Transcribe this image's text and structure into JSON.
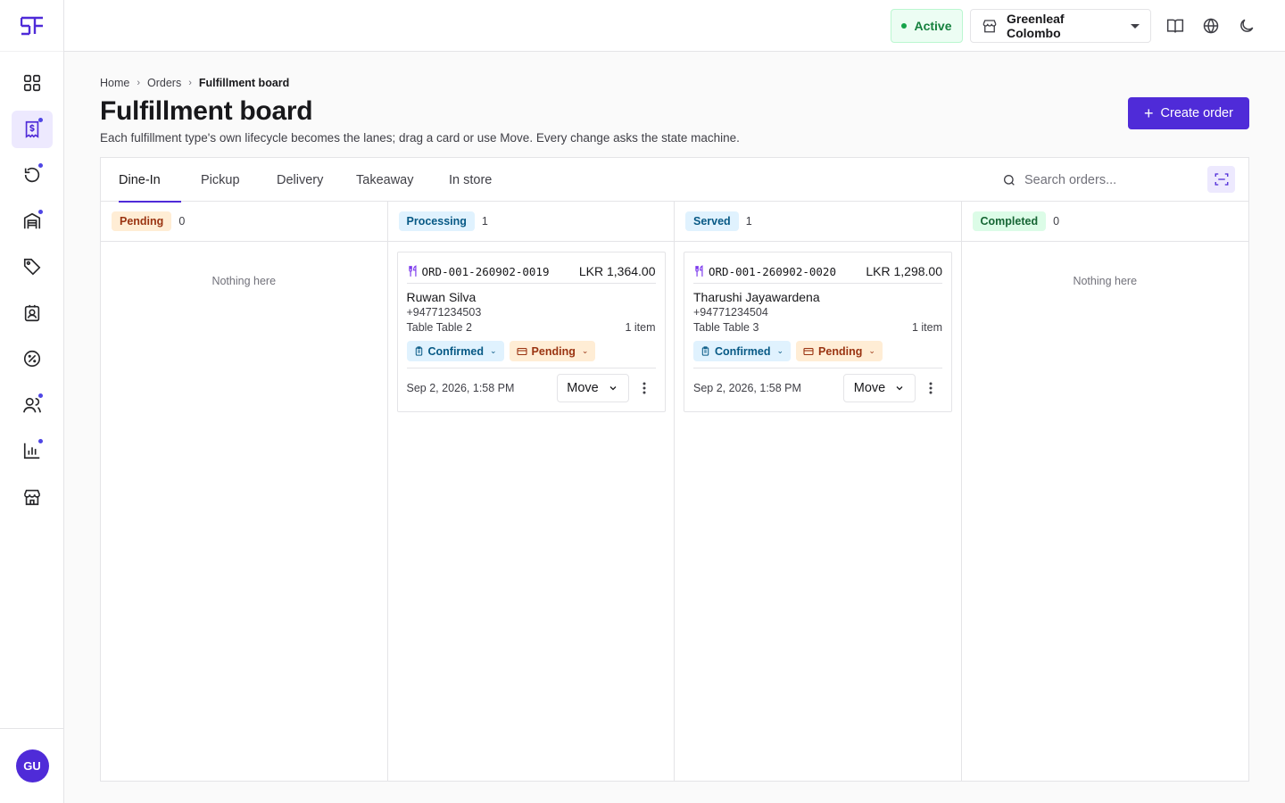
{
  "app": {
    "logo_icon": "sf-logo-icon",
    "accent": "#4f2bd8"
  },
  "sidebar": {
    "items": [
      {
        "name": "dashboard",
        "icon": "grid-icon",
        "active": false,
        "dot": false
      },
      {
        "name": "orders",
        "icon": "invoice-icon",
        "active": true,
        "dot": true
      },
      {
        "name": "returns",
        "icon": "refresh-icon",
        "active": false,
        "dot": true
      },
      {
        "name": "inventory",
        "icon": "warehouse-icon",
        "active": false,
        "dot": true
      },
      {
        "name": "promotions",
        "icon": "tag-icon",
        "active": false,
        "dot": false
      },
      {
        "name": "customers",
        "icon": "contact-icon",
        "active": false,
        "dot": false
      },
      {
        "name": "discounts",
        "icon": "percent-icon",
        "active": false,
        "dot": false
      },
      {
        "name": "staff",
        "icon": "users-icon",
        "active": false,
        "dot": true
      },
      {
        "name": "reports",
        "icon": "bar-chart-icon",
        "active": false,
        "dot": true
      },
      {
        "name": "stores",
        "icon": "store-icon",
        "active": false,
        "dot": false
      }
    ],
    "avatar_initials": "GU"
  },
  "topbar": {
    "status": "Active",
    "store": "Greenleaf Colombo"
  },
  "breadcrumb": {
    "home": "Home",
    "orders": "Orders",
    "current": "Fulfillment board"
  },
  "page": {
    "title": "Fulfillment board",
    "subtitle": "Each fulfillment type's own lifecycle becomes the lanes; drag a card or use Move. Every change asks the state machine.",
    "create_label": "Create order"
  },
  "tabs": [
    "Dine-In",
    "Pickup",
    "Delivery",
    "Takeaway",
    "In store"
  ],
  "active_tab": "Dine-In",
  "search": {
    "placeholder": "Search orders..."
  },
  "lanes": [
    {
      "label": "Pending",
      "count": "0",
      "empty_text": "Nothing here"
    },
    {
      "label": "Processing",
      "count": "1"
    },
    {
      "label": "Served",
      "count": "1"
    },
    {
      "label": "Completed",
      "count": "0",
      "empty_text": "Nothing here"
    }
  ],
  "cards": [
    {
      "order_id": "ORD-001-260902-0019",
      "amount": "LKR 1,364.00",
      "customer": "Ruwan Silva",
      "phone": "+94771234503",
      "table": "Table Table 2",
      "items": "1 item",
      "status_chip": "Confirmed",
      "payment_chip": "Pending",
      "date": "Sep 2, 2026, 1:58 PM",
      "move_label": "Move"
    },
    {
      "order_id": "ORD-001-260902-0020",
      "amount": "LKR 1,298.00",
      "customer": "Tharushi Jayawardena",
      "phone": "+94771234504",
      "table": "Table Table 3",
      "items": "1 item",
      "status_chip": "Confirmed",
      "payment_chip": "Pending",
      "date": "Sep 2, 2026, 1:58 PM",
      "move_label": "Move"
    }
  ]
}
